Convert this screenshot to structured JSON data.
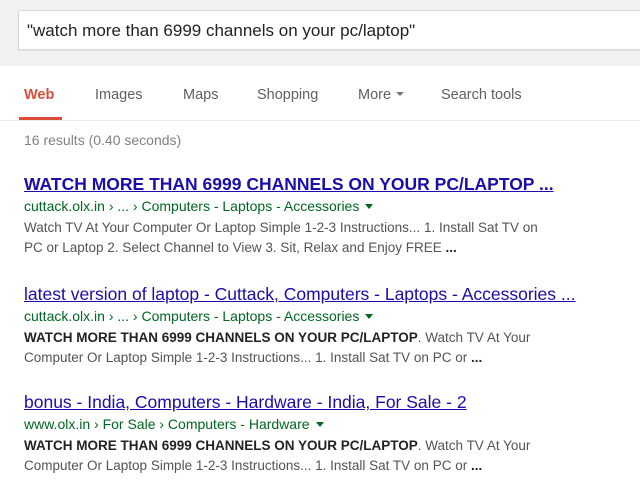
{
  "search": {
    "query": "\"watch more than 6999 channels on your pc/laptop\""
  },
  "tabs": [
    {
      "label": "Web",
      "active": true
    },
    {
      "label": "Images"
    },
    {
      "label": "Maps"
    },
    {
      "label": "Shopping"
    },
    {
      "label": "More"
    },
    {
      "label": "Search tools"
    }
  ],
  "stats": "16 results (0.40 seconds)",
  "results": [
    {
      "title": "WATCH MORE THAN 6999 CHANNELS ON YOUR PC/LAPTOP ...",
      "url": "cuttack.olx.in › ... › Computers - Laptops - Accessories",
      "snippet_bold": "",
      "snippet_line1": "Watch TV At Your Computer Or Laptop Simple 1-2-3 Instructions... 1. Install Sat TV on",
      "snippet_line2": "PC or Laptop 2. Select Channel to View 3. Sit, Relax and Enjoy FREE ",
      "snippet_end": "..."
    },
    {
      "title": "latest version of laptop - Cuttack, Computers - Laptops - Accessories ...",
      "url": "cuttack.olx.in › ... › Computers - Laptops - Accessories",
      "snippet_bold": "WATCH MORE THAN 6999 CHANNELS ON YOUR PC/LAPTOP",
      "snippet_line1": ". Watch TV At Your",
      "snippet_line2": "Computer Or Laptop Simple 1-2-3 Instructions... 1. Install Sat TV on PC or ",
      "snippet_end": "..."
    },
    {
      "title": "bonus - India, Computers - Hardware - India, For Sale - 2",
      "url": "www.olx.in › For Sale › Computers - Hardware",
      "snippet_bold": "WATCH MORE THAN 6999 CHANNELS ON YOUR PC/LAPTOP",
      "snippet_line1": ". Watch TV At Your",
      "snippet_line2": "Computer Or Laptop Simple 1-2-3 Instructions... 1. Install Sat TV on PC or ",
      "snippet_end": "..."
    }
  ]
}
